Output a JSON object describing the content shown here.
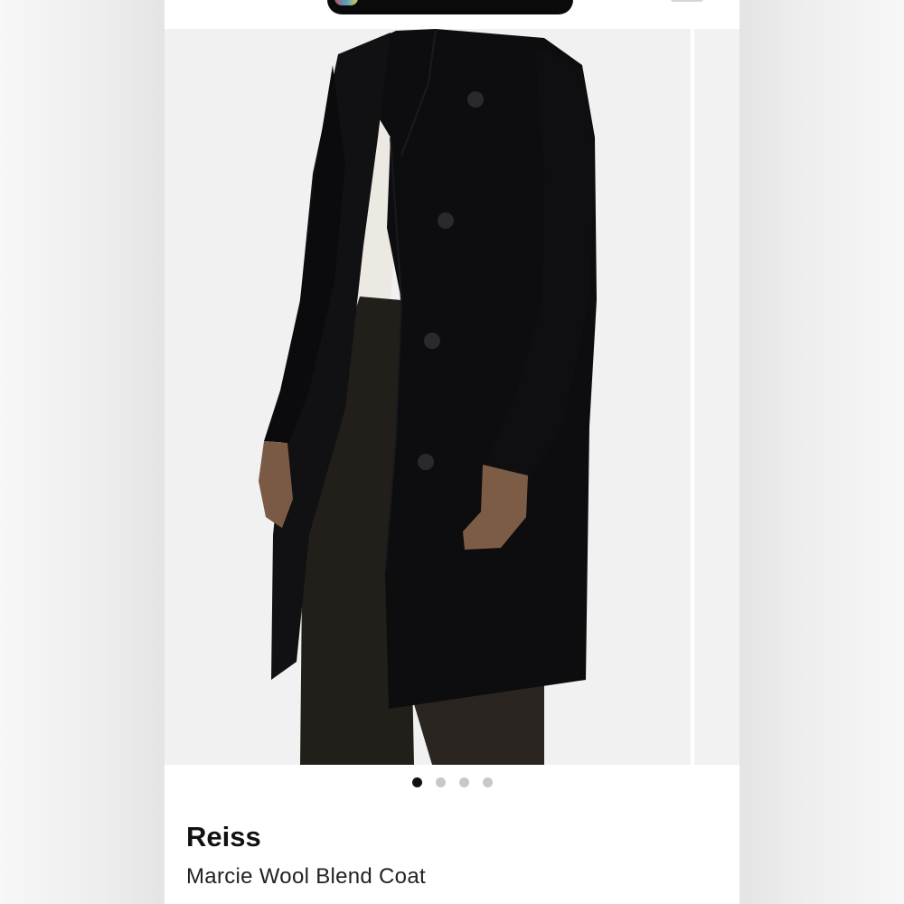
{
  "product": {
    "brand": "Reiss",
    "name": "Marcie Wool Blend Coat"
  },
  "gallery": {
    "image_subject": "black-wool-coat-photo",
    "slide_count": 4,
    "active_slide": 1
  },
  "colors": {
    "coat": "#0d0d0f",
    "background": "#f1f1f1",
    "dot_active": "#111111",
    "dot_inactive": "#c8c8c8"
  }
}
